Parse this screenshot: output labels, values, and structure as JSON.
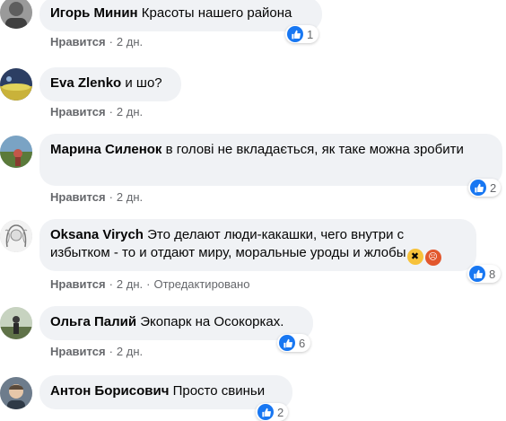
{
  "actions": {
    "like": "Нравится",
    "edited": "Отредактировано"
  },
  "comments": [
    {
      "author": "Игорь Минин",
      "text": "Красоты нашего района",
      "time": "2 дн.",
      "reactions": "1"
    },
    {
      "author": "Eva Zlenko",
      "text": "и шо?",
      "time": "2 дн.",
      "reactions": ""
    },
    {
      "author": "Марина Силенок",
      "text": "в голові не вкладається, як таке можна зробити",
      "time": "2 дн.",
      "reactions": "2"
    },
    {
      "author": "Oksana Virych",
      "text": "Это делают люди-какашки, чего внутри с избытком - то и отдают миру, моральные уроды и жлобы",
      "time": "2 дн.",
      "reactions": "8",
      "emojis": [
        "tired-face-emoji",
        "angry-face-emoji"
      ]
    },
    {
      "author": "Ольга Палий",
      "text": "Экопарк на Осокорках.",
      "time": "2 дн.",
      "reactions": "6"
    },
    {
      "author": "Антон Борисович",
      "text": "Просто свиньи",
      "time": "",
      "reactions": "2"
    }
  ],
  "colors": {
    "bubble": "#f0f2f5",
    "meta": "#65676b",
    "like_blue": "#1877f2"
  }
}
